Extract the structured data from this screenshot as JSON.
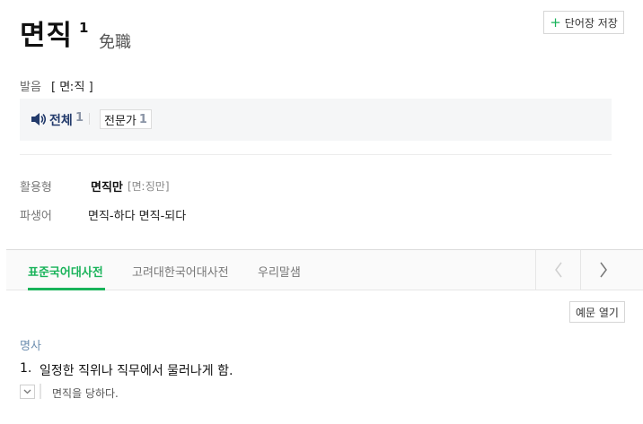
{
  "entry": {
    "headword": "면직",
    "homonym_number": "1",
    "hanja": "免職"
  },
  "toolbar": {
    "save_label": "단어장 저장",
    "save_icon": "plus-icon"
  },
  "pronunciation": {
    "label": "발음",
    "value": "[ 면ː직 ]"
  },
  "audio": {
    "all_label": "전체",
    "all_count": "1",
    "expert_label": "전문가",
    "expert_count": "1",
    "speaker_icon": "speaker-icon"
  },
  "forms": {
    "inflection_label": "활용형",
    "inflection_word": "면직만",
    "inflection_pron": "[면ː징만]",
    "derivative_label": "파생어",
    "derivatives": "면직-하다 면직-되다"
  },
  "tabs": [
    {
      "label": "표준국어대사전",
      "active": true
    },
    {
      "label": "고려대한국어대사전",
      "active": false
    },
    {
      "label": "우리말샘",
      "active": false
    }
  ],
  "colors": {
    "accent": "#19b35a",
    "audio_label": "#223a6b",
    "pos_label": "#6e8fb0"
  },
  "example_toggle_label": "예문 열기",
  "definition": {
    "pos": "명사",
    "number": "1.",
    "text": "일정한 직위나 직무에서 물러나게 함.",
    "example": "면직을 당하다."
  }
}
